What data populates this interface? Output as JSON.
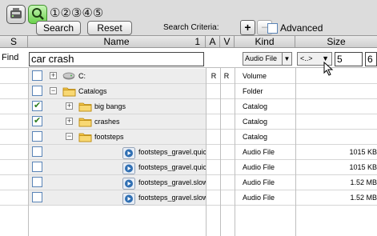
{
  "toolbar": {
    "circled_numbers": "①②③④⑤",
    "search_label": "Search",
    "reset_label": "Reset",
    "criteria_label": "Search Criteria:",
    "add_label": "+",
    "remove_label": "−",
    "advanced_label": "Advanced"
  },
  "header": {
    "col_s": "S",
    "col_name": "Name",
    "col_sort": "1",
    "col_a": "A",
    "col_v": "V",
    "col_kind": "Kind",
    "col_size": "Size"
  },
  "find": {
    "label": "Find",
    "query": "car crash",
    "kind_filter": "Audio File",
    "size_operator": "<..>",
    "size_min": "5",
    "size_max": "6"
  },
  "rows": [
    {
      "name": "C:",
      "a": "R",
      "v": "R",
      "kind": "Volume",
      "size": "",
      "checked": false,
      "expander": "⊞",
      "icon": "disk-icon",
      "indent": 0
    },
    {
      "name": "Catalogs",
      "a": "",
      "v": "",
      "kind": "Folder",
      "size": "",
      "checked": false,
      "expander": "⊟",
      "icon": "folder-icon",
      "indent": 0
    },
    {
      "name": "big bangs",
      "a": "",
      "v": "",
      "kind": "Catalog",
      "size": "",
      "checked": true,
      "expander": "⊞",
      "icon": "folder-icon",
      "indent": 1
    },
    {
      "name": "crashes",
      "a": "",
      "v": "",
      "kind": "Catalog",
      "size": "",
      "checked": true,
      "expander": "⊞",
      "icon": "folder-icon",
      "indent": 1
    },
    {
      "name": "footsteps",
      "a": "",
      "v": "",
      "kind": "Catalog",
      "size": "",
      "checked": false,
      "expander": "⊟",
      "icon": "folder-icon",
      "indent": 1
    },
    {
      "name": "footsteps_gravel.quick",
      "a": "",
      "v": "",
      "kind": "Audio File",
      "size": "1015 KB",
      "checked": false,
      "expander": "",
      "icon": "audio-file-icon",
      "indent": 2
    },
    {
      "name": "footsteps_gravel.quick",
      "a": "",
      "v": "",
      "kind": "Audio File",
      "size": "1015 KB",
      "checked": false,
      "expander": "",
      "icon": "audio-file-icon",
      "indent": 2
    },
    {
      "name": "footsteps_gravel.slow",
      "a": "",
      "v": "",
      "kind": "Audio File",
      "size": "1.52 MB",
      "checked": false,
      "expander": "",
      "icon": "audio-file-icon",
      "indent": 2
    },
    {
      "name": "footsteps_gravel.slow",
      "a": "",
      "v": "",
      "kind": "Audio File",
      "size": "1.52 MB",
      "checked": false,
      "expander": "",
      "icon": "audio-file-icon",
      "indent": 2
    }
  ],
  "colors": {
    "toolbar_bg": "#dcdcdc",
    "search_button_accent": "#6cd24d",
    "row_name_bg": "#ededed",
    "checkbox_border": "#5a84b7",
    "folder_yellow": "#f3c54a"
  }
}
